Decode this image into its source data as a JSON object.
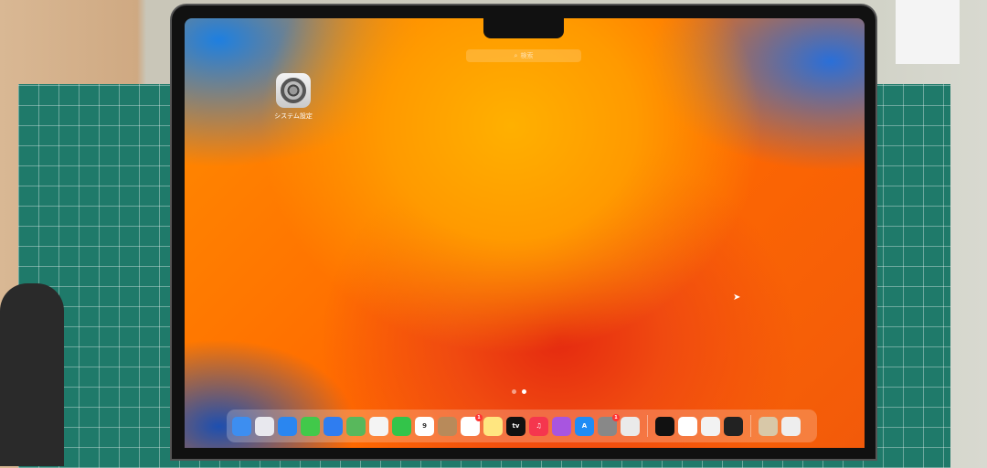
{
  "search": {
    "placeholder": "検索"
  },
  "launchpad_apps": [
    {
      "label": "システム設定",
      "icon": "system-settings-icon"
    }
  ],
  "page_indicator": {
    "pages": 2,
    "current": 2
  },
  "dock": {
    "apps": [
      {
        "name": "finder",
        "color": "#3d8ef0"
      },
      {
        "name": "launchpad",
        "color": "#e8e8ee"
      },
      {
        "name": "safari",
        "color": "#2a86f0"
      },
      {
        "name": "messages",
        "color": "#41c94a"
      },
      {
        "name": "mail",
        "color": "#2f7df0"
      },
      {
        "name": "maps",
        "color": "#58b85c"
      },
      {
        "name": "photos",
        "color": "#f4f4f4"
      },
      {
        "name": "facetime",
        "color": "#33c44a"
      },
      {
        "name": "calendar",
        "color": "#ffffff",
        "text": "9"
      },
      {
        "name": "contacts",
        "color": "#b88a5a"
      },
      {
        "name": "reminders",
        "color": "#ffffff",
        "badge": "1"
      },
      {
        "name": "notes",
        "color": "#ffe680"
      },
      {
        "name": "tv",
        "color": "#111111",
        "text": "tv"
      },
      {
        "name": "music",
        "color": "#f5364e",
        "text": "♫"
      },
      {
        "name": "podcasts",
        "color": "#a855e0"
      },
      {
        "name": "app-store",
        "color": "#1f8cf5",
        "text": "A"
      },
      {
        "name": "system-settings",
        "color": "#888888",
        "badge": "1"
      },
      {
        "name": "chrome",
        "color": "#eaeaea"
      }
    ],
    "extra": [
      {
        "name": "quik",
        "color": "#111111"
      },
      {
        "name": "app-blue-wave",
        "color": "#ffffff"
      },
      {
        "name": "preview",
        "color": "#f2f2f2"
      },
      {
        "name": "piano",
        "color": "#222222"
      }
    ],
    "stacks": [
      {
        "name": "downloads-stack",
        "color": "#d8c8a8"
      },
      {
        "name": "trash",
        "color": "#eeeeee"
      }
    ]
  }
}
